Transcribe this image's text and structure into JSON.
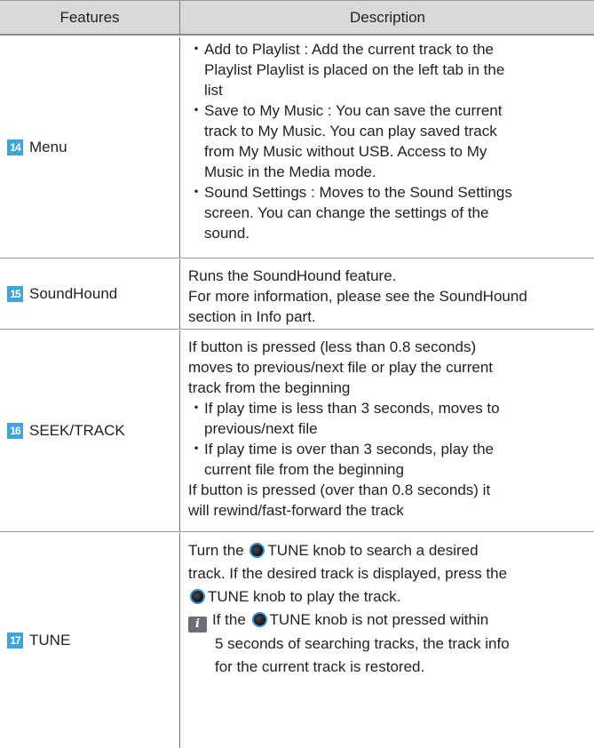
{
  "header": {
    "features": "Features",
    "description": "Description"
  },
  "rows": [
    {
      "number": "14",
      "feature": "Menu",
      "bullets": [
        [
          "Add to Playlist : Add the current track to the",
          "Playlist Playlist is placed on the left tab in the",
          "list"
        ],
        [
          "Save to My Music : You can save the current",
          "track to My Music. You can play saved track",
          "from My Music without USB.  Access to My",
          "Music in the Media mode."
        ],
        [
          "Sound Settings : Moves to the Sound Settings",
          "screen. You can change the settings of the",
          "sound."
        ]
      ]
    },
    {
      "number": "15",
      "feature": "SoundHound",
      "lines": [
        "Runs the SoundHound feature.",
        "For more information, please see the SoundHound",
        "section in Info part."
      ]
    },
    {
      "number": "16",
      "feature": "SEEK/TRACK",
      "intro": [
        "If button is pressed (less than 0.8 seconds)",
        "moves to previous/next file or play the current",
        "track from the beginning"
      ],
      "bullets": [
        [
          "If play time is less than 3 seconds, moves to",
          "previous/next file"
        ],
        [
          "If play time is over than 3 seconds, play the",
          "current file from the beginning"
        ]
      ],
      "outro": [
        "If button is pressed (over than 0.8 seconds) it",
        "will rewind/fast-forward the track"
      ]
    },
    {
      "number": "17",
      "feature": "TUNE",
      "line1_pre": "Turn the",
      "line1_post": "TUNE knob to search a desired",
      "line2": "track. If the desired track is displayed, press the",
      "line3_post": "TUNE knob to play the track.",
      "info_icon": "i",
      "info_pre": "If the",
      "info_post": "TUNE knob is not pressed within",
      "info_line2": "5 seconds of searching tracks, the track info",
      "info_line3": "for the current track is restored."
    }
  ],
  "colors": {
    "number_badge": "#3fa3dc",
    "header_bg": "#d9d9d9",
    "knob_ring": "#2e8fd6"
  }
}
